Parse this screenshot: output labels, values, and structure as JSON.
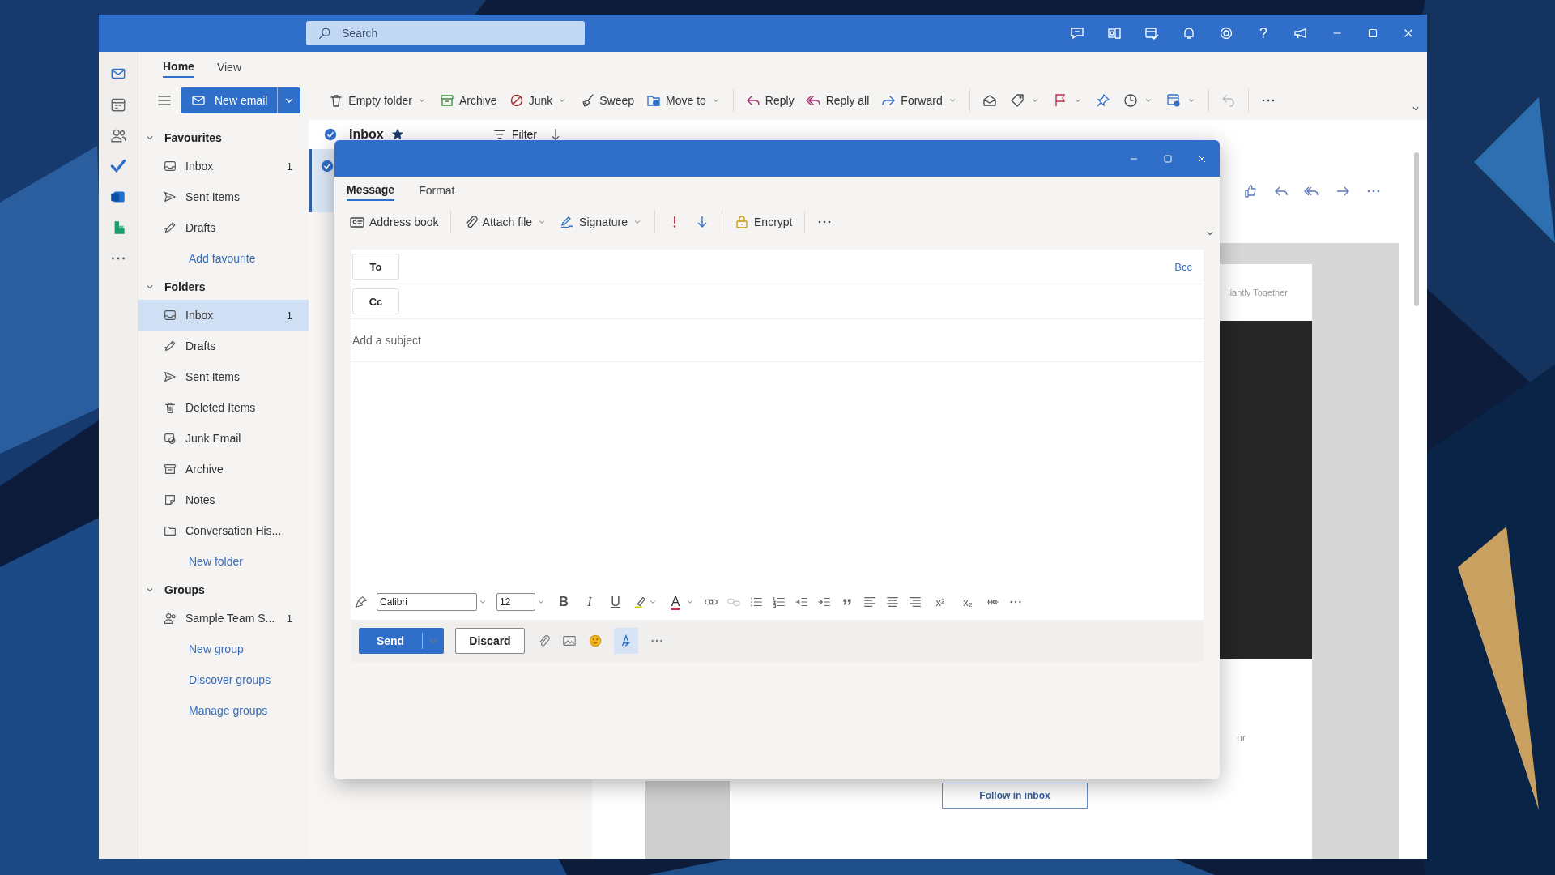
{
  "search": {
    "placeholder": "Search"
  },
  "help_glyph": "?",
  "ribbon_tabs": [
    {
      "label": "Home",
      "selected": true
    },
    {
      "label": "View",
      "selected": false
    }
  ],
  "new_email": "New email",
  "ribbon_commands": [
    {
      "label": "Empty folder",
      "dropdown": true
    },
    {
      "label": "Archive",
      "dropdown": false
    },
    {
      "label": "Junk",
      "dropdown": true
    },
    {
      "label": "Sweep",
      "dropdown": false
    },
    {
      "label": "Move to",
      "dropdown": true
    },
    {
      "label": "Reply",
      "dropdown": false
    },
    {
      "label": "Reply all",
      "dropdown": false
    },
    {
      "label": "Forward",
      "dropdown": true
    }
  ],
  "sections": [
    {
      "title": "Favourites",
      "expanded": true,
      "items": [
        {
          "label": "Inbox",
          "kind": "inbox",
          "count": "1",
          "selected": false
        },
        {
          "label": "Sent Items",
          "kind": "sent",
          "selected": false
        },
        {
          "label": "Drafts",
          "kind": "drafts",
          "selected": false
        }
      ],
      "links": [
        "Add favourite"
      ]
    },
    {
      "title": "Folders",
      "expanded": true,
      "items": [
        {
          "label": "Inbox",
          "kind": "inbox",
          "count": "1",
          "selected": true
        },
        {
          "label": "Drafts",
          "kind": "drafts",
          "selected": false
        },
        {
          "label": "Sent Items",
          "kind": "sent",
          "selected": false
        },
        {
          "label": "Deleted Items",
          "kind": "deleted",
          "selected": false
        },
        {
          "label": "Junk Email",
          "kind": "junk",
          "selected": false
        },
        {
          "label": "Archive",
          "kind": "archive",
          "selected": false
        },
        {
          "label": "Notes",
          "kind": "notes",
          "selected": false
        },
        {
          "label": "Conversation His...",
          "kind": "folder",
          "selected": false
        }
      ],
      "links": [
        "New folder"
      ]
    },
    {
      "title": "Groups",
      "expanded": true,
      "items": [
        {
          "label": "Sample Team S...",
          "kind": "group",
          "count": "1",
          "selected": false
        }
      ],
      "links": [
        "New group",
        "Discover groups",
        "Manage groups"
      ]
    }
  ],
  "message_list": {
    "title": "Inbox",
    "favourite": true,
    "filter": "Filter"
  },
  "reading_pane": {
    "banner_text": "liantly Together",
    "side_text": "or",
    "follow_button": "Follow in inbox"
  },
  "compose": {
    "tabs": [
      {
        "label": "Message",
        "selected": true
      },
      {
        "label": "Format",
        "selected": false
      }
    ],
    "commands": [
      {
        "label": "Address book",
        "dropdown": false
      },
      {
        "label": "Attach file",
        "dropdown": true
      },
      {
        "label": "Signature",
        "dropdown": true
      },
      {
        "label": "Encrypt",
        "dropdown": false
      }
    ],
    "recipients": [
      {
        "label": "To",
        "extra": "Bcc"
      },
      {
        "label": "Cc"
      }
    ],
    "subject": {
      "placeholder": "Add a subject"
    },
    "font": "Calibri",
    "size": "12",
    "text_styles": [
      {
        "text": "B",
        "kind": "bold"
      },
      {
        "text": "I",
        "kind": "italic"
      },
      {
        "text": "U",
        "kind": "underline"
      }
    ],
    "font_color": "A",
    "superscript": "x²",
    "subscript": "x₂",
    "send": "Send",
    "discard": "Discard"
  }
}
